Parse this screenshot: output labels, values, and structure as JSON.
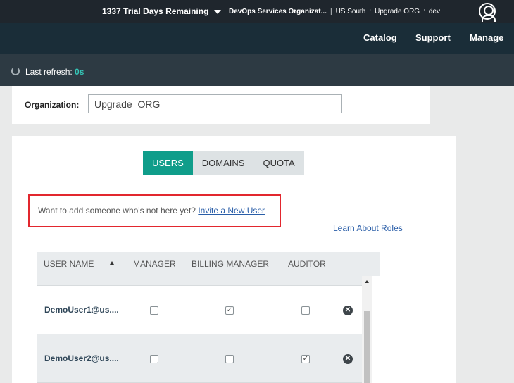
{
  "topbar": {
    "trial": "1337 Trial Days Remaining",
    "org": "DevOps Services Organizat...",
    "sep1": "|",
    "region": "US South",
    "sep2": ":",
    "org_name": "Upgrade ORG",
    "sep3": ":",
    "space": "dev"
  },
  "nav": {
    "catalog": "Catalog",
    "support": "Support",
    "manage": "Manage"
  },
  "refresh": {
    "label": "Last refresh:",
    "value": "0s"
  },
  "organization": {
    "label": "Organization:",
    "value": "Upgrade  ORG"
  },
  "tabs": [
    {
      "label": "USERS",
      "active": true
    },
    {
      "label": "DOMAINS",
      "active": false
    },
    {
      "label": "QUOTA",
      "active": false
    }
  ],
  "invite": {
    "text": "Want to add someone who's not here yet?",
    "link": "Invite a New User"
  },
  "learn_link": "Learn About Roles",
  "table": {
    "headers": {
      "username": "USER NAME",
      "manager": "MANAGER",
      "billing": "BILLING MANAGER",
      "auditor": "AUDITOR"
    },
    "rows": [
      {
        "name": "DemoUser1@us....",
        "manager": false,
        "billing": true,
        "auditor": false
      },
      {
        "name": "DemoUser2@us....",
        "manager": false,
        "billing": false,
        "auditor": true
      }
    ]
  },
  "colors": {
    "accent": "#0f9d8a",
    "refresh_value": "#35c6b7",
    "highlight_border": "#e2272e"
  }
}
